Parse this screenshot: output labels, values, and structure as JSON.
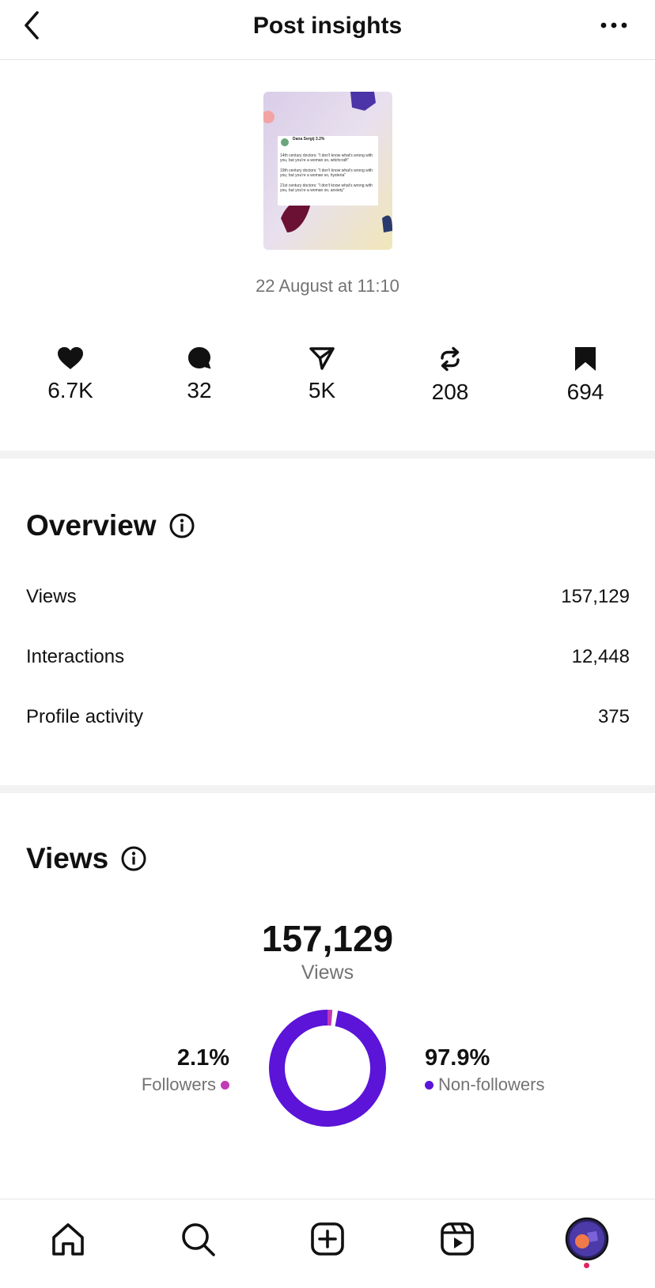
{
  "header": {
    "title": "Post insights"
  },
  "post": {
    "date": "22 August at 11:10",
    "thumbnail": {
      "author": "Dana Sergij 3.2%",
      "line1": "14th century doctors: \"I don't know what's wrong with you, but you're a woman so, witchcraft\"",
      "line2": "19th century doctors: \"I don't know what's wrong with you, but you're a woman so, hysteria\"",
      "line3": "21st century doctors: \"I don't know what's wrong with you, but you're a woman so, anxiety\""
    }
  },
  "stats": [
    {
      "icon": "heart-icon",
      "value": "6.7K"
    },
    {
      "icon": "comment-icon",
      "value": "32"
    },
    {
      "icon": "share-icon",
      "value": "5K"
    },
    {
      "icon": "repost-icon",
      "value": "208"
    },
    {
      "icon": "bookmark-icon",
      "value": "694"
    }
  ],
  "overview": {
    "title": "Overview",
    "rows": [
      {
        "label": "Views",
        "value": "157,129"
      },
      {
        "label": "Interactions",
        "value": "12,448"
      },
      {
        "label": "Profile activity",
        "value": "375"
      }
    ]
  },
  "views": {
    "title": "Views",
    "total": "157,129",
    "total_label": "Views",
    "followers": {
      "percent": "2.1%",
      "label": "Followers",
      "fraction": 0.021,
      "color": "#c13ab4"
    },
    "non_followers": {
      "percent": "97.9%",
      "label": "Non-followers",
      "fraction": 0.979,
      "color": "#5b14d8"
    }
  },
  "colors": {
    "text": "#111111",
    "muted": "#737373",
    "notification_dot": "#e0245e"
  },
  "tabbar": {
    "items": [
      "home-icon",
      "search-icon",
      "create-icon",
      "reels-icon",
      "profile-avatar"
    ]
  }
}
